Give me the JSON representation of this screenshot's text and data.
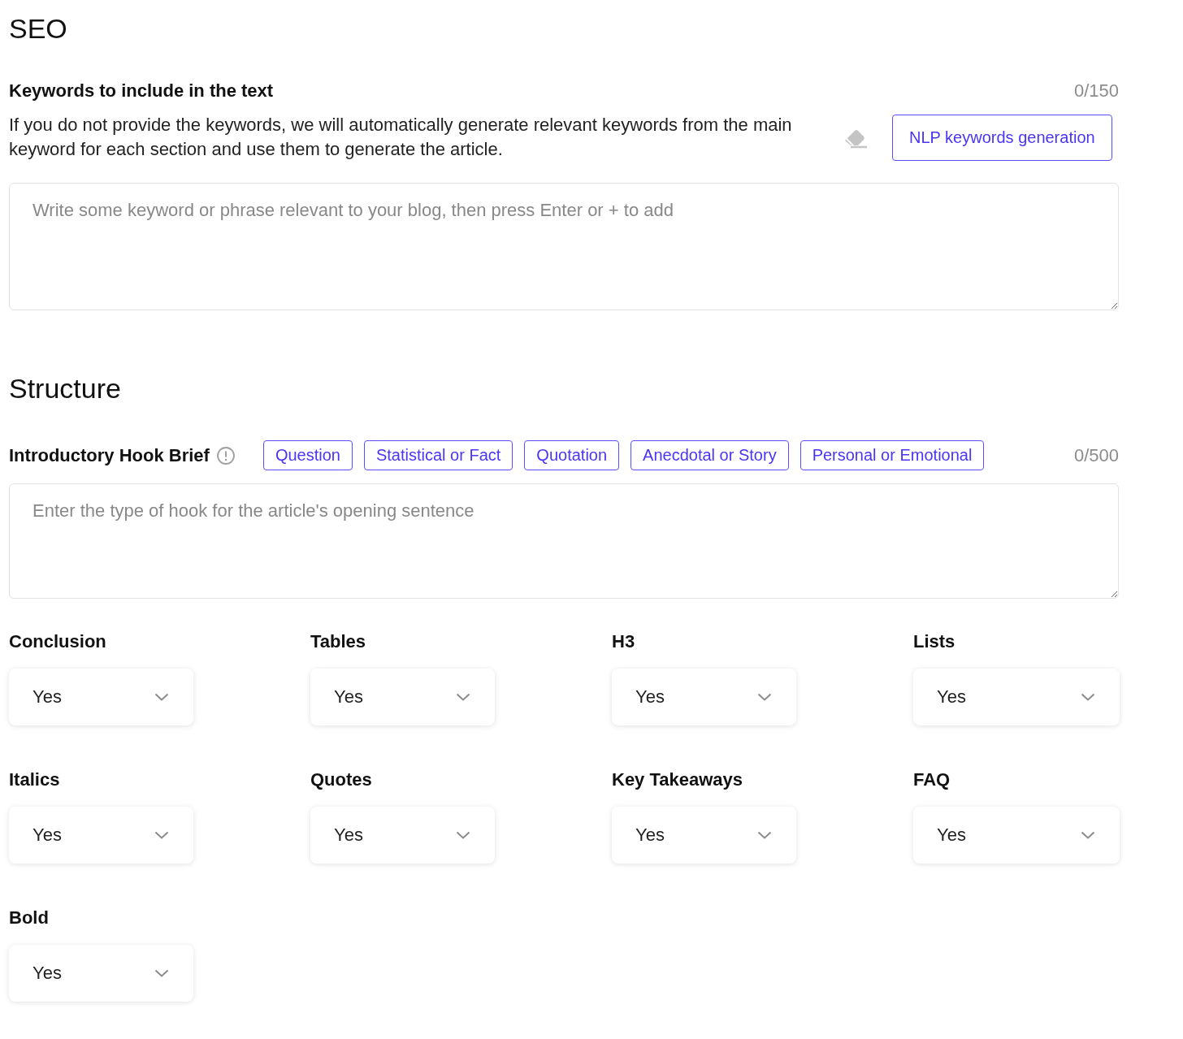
{
  "seo": {
    "title": "SEO",
    "keywords": {
      "label": "Keywords to include in the text",
      "counter": "0/150",
      "description": "If you do not provide the keywords, we will automatically generate relevant keywords from the main keyword for each section and use them to generate the article.",
      "button": "NLP keywords generation",
      "placeholder": "Write some keyword or phrase relevant to your blog, then press Enter or + to add"
    }
  },
  "structure": {
    "title": "Structure",
    "hook": {
      "label": "Introductory Hook Brief",
      "counter": "0/500",
      "placeholder": "Enter the type of hook for the article's opening sentence",
      "chips": [
        {
          "label": "Question",
          "selected": false
        },
        {
          "label": "Statistical or Fact",
          "selected": false
        },
        {
          "label": "Quotation",
          "selected": false
        },
        {
          "label": "Anecdotal or Story",
          "selected": false
        },
        {
          "label": "Personal or Emotional",
          "selected": false
        }
      ]
    },
    "options": [
      {
        "label": "Conclusion",
        "value": "Yes"
      },
      {
        "label": "Tables",
        "value": "Yes"
      },
      {
        "label": "H3",
        "value": "Yes"
      },
      {
        "label": "Lists",
        "value": "Yes"
      },
      {
        "label": "Italics",
        "value": "Yes"
      },
      {
        "label": "Quotes",
        "value": "Yes"
      },
      {
        "label": "Key Takeaways",
        "value": "Yes"
      },
      {
        "label": "FAQ",
        "value": "Yes"
      },
      {
        "label": "Bold",
        "value": "Yes"
      }
    ]
  }
}
